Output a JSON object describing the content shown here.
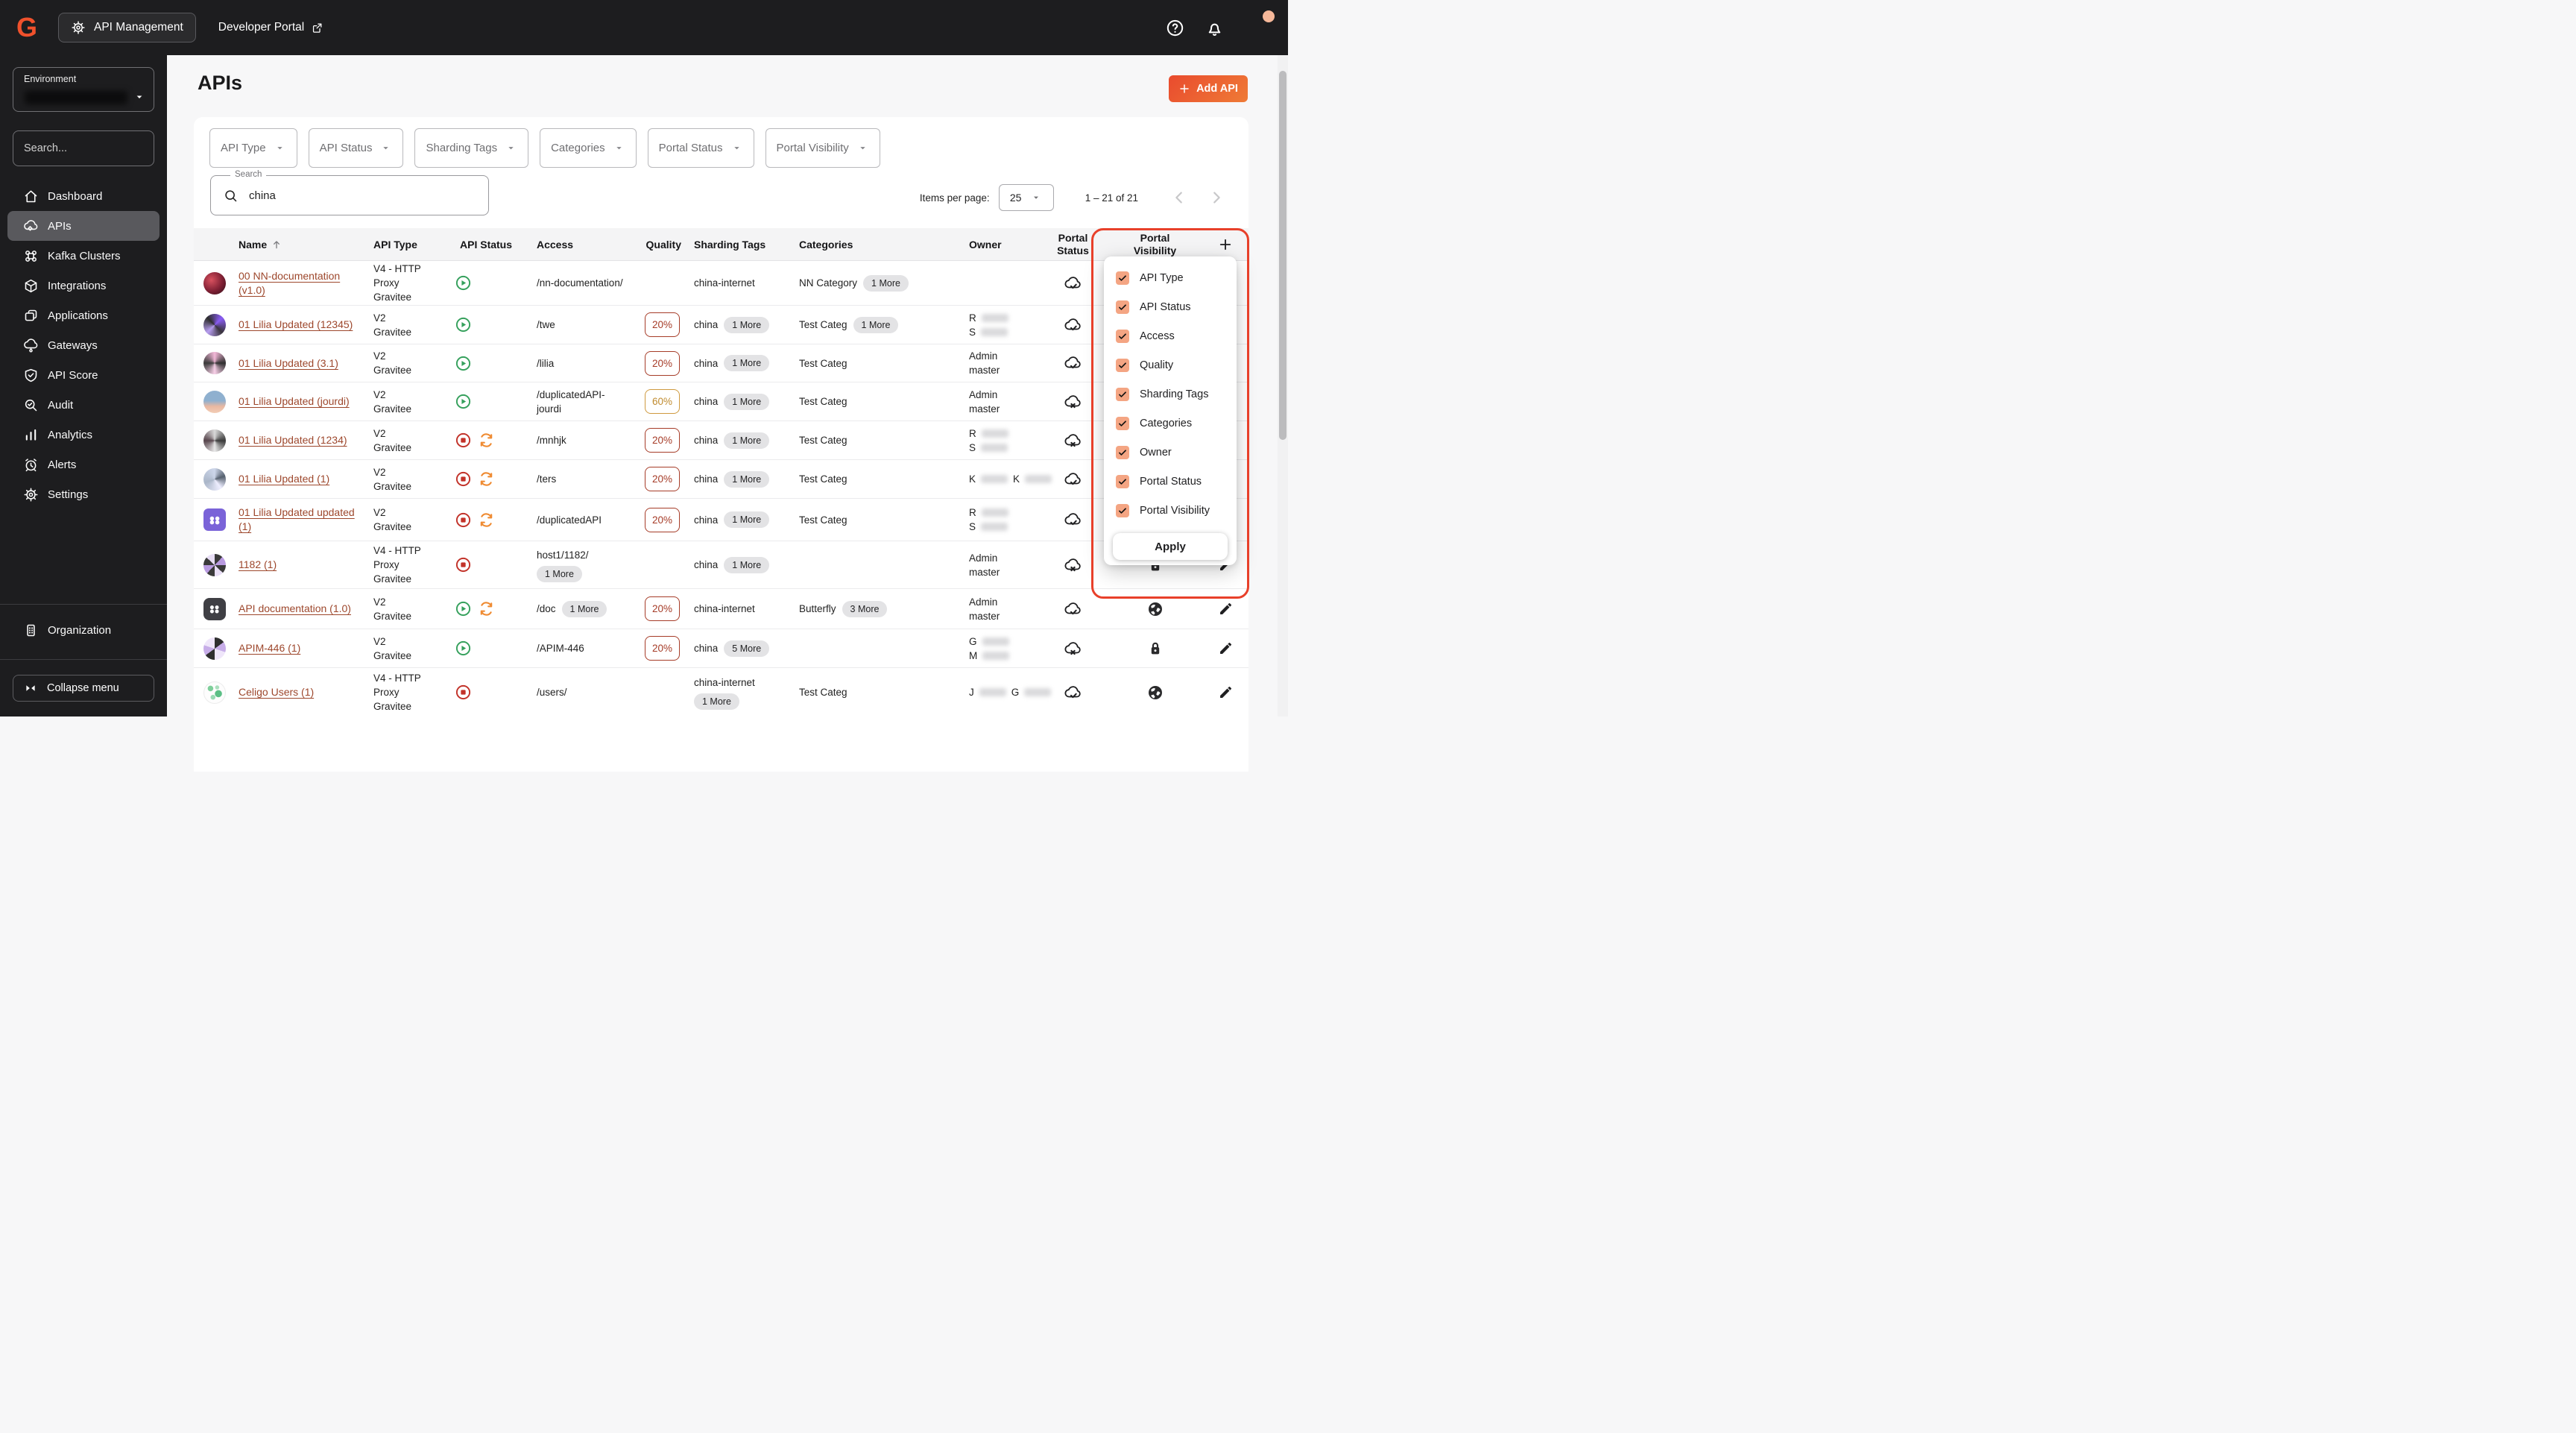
{
  "topbar": {
    "app_title": "API Management",
    "portal_label": "Developer Portal"
  },
  "sidebar": {
    "environment_label": "Environment",
    "environment_value_redacted": true,
    "search_placeholder": "Search...",
    "items": [
      {
        "label": "Dashboard",
        "icon": "home"
      },
      {
        "label": "APIs",
        "icon": "cloud-gear"
      },
      {
        "label": "Kafka Clusters",
        "icon": "kafka"
      },
      {
        "label": "Integrations",
        "icon": "cube"
      },
      {
        "label": "Applications",
        "icon": "windows"
      },
      {
        "label": "Gateways",
        "icon": "cloud-node"
      },
      {
        "label": "API Score",
        "icon": "shield-check"
      },
      {
        "label": "Audit",
        "icon": "search-check"
      },
      {
        "label": "Analytics",
        "icon": "bar-chart"
      },
      {
        "label": "Alerts",
        "icon": "alarm"
      },
      {
        "label": "Settings",
        "icon": "gear"
      }
    ],
    "selected": "APIs",
    "organization_label": "Organization",
    "collapse_label": "Collapse menu"
  },
  "header": {
    "title": "APIs",
    "add_label": "Add API"
  },
  "filters": {
    "dropdowns": [
      "API Type",
      "API Status",
      "Sharding Tags",
      "Categories",
      "Portal Status",
      "Portal Visibility"
    ]
  },
  "search": {
    "label": "Search",
    "value": "china"
  },
  "pagination": {
    "items_per_page_label": "Items per page:",
    "items_per_page": "25",
    "range": "1 – 21 of 21"
  },
  "table": {
    "columns": [
      "Name",
      "API Type",
      "API Status",
      "Access",
      "Quality",
      "Sharding Tags",
      "Categories",
      "Owner",
      "Portal Status",
      "Portal Visibility"
    ],
    "rows": [
      {
        "name": "00 NN-documentation (v1.0)",
        "avatar": "crowd-photo",
        "type_lines": [
          "V4 - HTTP",
          "Proxy",
          "Gravitee"
        ],
        "status": [
          "started"
        ],
        "access": "/nn-documentation/",
        "access_more": null,
        "quality": null,
        "tags": {
          "label": "china-internet",
          "more": null,
          "more_pos": "inline"
        },
        "categories": {
          "label": "NN Category",
          "more": "1 More"
        },
        "owner": {
          "lines": [],
          "redacted": false
        },
        "portal_status": "published",
        "visibility": null
      },
      {
        "name": "01 Lilia Updated (12345)",
        "avatar": "purple-pattern",
        "type_lines": [
          "V2",
          "Gravitee"
        ],
        "status": [
          "started"
        ],
        "access": "/twe",
        "access_more": null,
        "quality": "20%",
        "tags": {
          "label": "china",
          "more": "1 More",
          "more_pos": "inline"
        },
        "categories": {
          "label": "Test Categ",
          "more": "1 More"
        },
        "owner": {
          "lines": [
            [
              "R"
            ],
            [
              "S"
            ]
          ],
          "redacted": true
        },
        "portal_status": "published",
        "visibility": null
      },
      {
        "name": "01 Lilia Updated (3.1)",
        "avatar": "pink-pattern",
        "type_lines": [
          "V2",
          "Gravitee"
        ],
        "status": [
          "started"
        ],
        "access": "/lilia",
        "access_more": null,
        "quality": "20%",
        "tags": {
          "label": "china",
          "more": "1 More",
          "more_pos": "inline"
        },
        "categories": {
          "label": "Test Categ",
          "more": null
        },
        "owner": {
          "lines": [
            [
              "Admin"
            ],
            [
              "master"
            ]
          ],
          "redacted": false
        },
        "portal_status": "published",
        "visibility": null
      },
      {
        "name": "01 Lilia Updated (jourdi)",
        "avatar": "sky-photo",
        "type_lines": [
          "V2",
          "Gravitee"
        ],
        "status": [
          "started"
        ],
        "access": "/duplicatedAPI-jourdi",
        "access_more": null,
        "quality": "60%",
        "tags": {
          "label": "china",
          "more": "1 More",
          "more_pos": "inline"
        },
        "categories": {
          "label": "Test Categ",
          "more": null
        },
        "owner": {
          "lines": [
            [
              "Admin"
            ],
            [
              "master"
            ]
          ],
          "redacted": false
        },
        "portal_status": "unpublished",
        "visibility": null
      },
      {
        "name": "01 Lilia Updated (1234)",
        "avatar": "gray-pattern",
        "type_lines": [
          "V2",
          "Gravitee"
        ],
        "status": [
          "stopped",
          "sync"
        ],
        "access": "/mnhjk",
        "access_more": null,
        "quality": "20%",
        "tags": {
          "label": "china",
          "more": "1 More",
          "more_pos": "inline"
        },
        "categories": {
          "label": "Test Categ",
          "more": null
        },
        "owner": {
          "lines": [
            [
              "R"
            ],
            [
              "S"
            ]
          ],
          "redacted": true
        },
        "portal_status": "unpublished",
        "visibility": null
      },
      {
        "name": "01 Lilia Updated (1)",
        "avatar": "lightblue-pattern",
        "type_lines": [
          "V2",
          "Gravitee"
        ],
        "status": [
          "stopped",
          "sync"
        ],
        "access": "/ters",
        "access_more": null,
        "quality": "20%",
        "tags": {
          "label": "china",
          "more": "1 More",
          "more_pos": "inline"
        },
        "categories": {
          "label": "Test Categ",
          "more": null
        },
        "owner": {
          "lines": [
            [
              "K",
              "K"
            ]
          ],
          "redacted": true
        },
        "portal_status": "published",
        "visibility": null
      },
      {
        "name": "01 Lilia Updated updated (1)",
        "avatar": "purple-hex",
        "type_lines": [
          "V2",
          "Gravitee"
        ],
        "status": [
          "stopped",
          "sync"
        ],
        "access": "/duplicatedAPI",
        "access_more": null,
        "quality": "20%",
        "tags": {
          "label": "china",
          "more": "1 More",
          "more_pos": "inline"
        },
        "categories": {
          "label": "Test Categ",
          "more": null
        },
        "owner": {
          "lines": [
            [
              "R"
            ],
            [
              "S"
            ]
          ],
          "redacted": true
        },
        "portal_status": "published",
        "visibility": null
      },
      {
        "name": "1182 (1)",
        "avatar": "purple-diamond",
        "type_lines": [
          "V4 - HTTP",
          "Proxy",
          "Gravitee"
        ],
        "status": [
          "stopped"
        ],
        "access": "host1/1182/",
        "access_more": {
          "label": "1 More",
          "pos": "below"
        },
        "quality": null,
        "tags": {
          "label": "china",
          "more": "1 More",
          "more_pos": "inline"
        },
        "categories": {
          "label": null,
          "more": null
        },
        "owner": {
          "lines": [
            [
              "Admin"
            ],
            [
              "master"
            ]
          ],
          "redacted": false
        },
        "portal_status": "unpublished",
        "visibility": "private"
      },
      {
        "name": "API documentation (1.0)",
        "avatar": "dark-badge",
        "type_lines": [
          "V2",
          "Gravitee"
        ],
        "status": [
          "started",
          "sync"
        ],
        "access": "/doc",
        "access_more": {
          "label": "1 More",
          "pos": "inline"
        },
        "quality": "20%",
        "tags": {
          "label": "china-internet",
          "more": null,
          "more_pos": "inline"
        },
        "categories": {
          "label": "Butterfly",
          "more": "3 More"
        },
        "owner": {
          "lines": [
            [
              "Admin"
            ],
            [
              "master"
            ]
          ],
          "redacted": false
        },
        "portal_status": "published",
        "visibility": "public"
      },
      {
        "name": "APIM-446 (1)",
        "avatar": "purple-diamond2",
        "type_lines": [
          "V2",
          "Gravitee"
        ],
        "status": [
          "started"
        ],
        "access": "/APIM-446",
        "access_more": null,
        "quality": "20%",
        "tags": {
          "label": "china",
          "more": "5 More",
          "more_pos": "inline"
        },
        "categories": {
          "label": null,
          "more": null
        },
        "owner": {
          "lines": [
            [
              "G"
            ],
            [
              "M"
            ]
          ],
          "redacted": true
        },
        "portal_status": "unpublished",
        "visibility": "private"
      },
      {
        "name": "Celigo Users (1)",
        "avatar": "green-sparkle",
        "type_lines": [
          "V4 - HTTP",
          "Proxy",
          "Gravitee"
        ],
        "status": [
          "stopped"
        ],
        "access": "/users/",
        "access_more": null,
        "quality": null,
        "tags": {
          "label": "china-internet",
          "more": "1 More",
          "more_pos": "below"
        },
        "categories": {
          "label": "Test Categ",
          "more": null
        },
        "owner": {
          "lines": [
            [
              "J",
              "G"
            ]
          ],
          "redacted": true
        },
        "portal_status": "published",
        "visibility": "public"
      }
    ]
  },
  "column_picker": {
    "options": [
      {
        "label": "API Type",
        "checked": true
      },
      {
        "label": "API Status",
        "checked": true
      },
      {
        "label": "Access",
        "checked": true
      },
      {
        "label": "Quality",
        "checked": true
      },
      {
        "label": "Sharding Tags",
        "checked": true
      },
      {
        "label": "Categories",
        "checked": true
      },
      {
        "label": "Owner",
        "checked": true
      },
      {
        "label": "Portal Status",
        "checked": true
      },
      {
        "label": "Portal Visibility",
        "checked": true
      }
    ],
    "apply_label": "Apply"
  },
  "colors": {
    "accent_orange": "#ee5a2c",
    "link_rust": "#9d472c",
    "quality_red": "#a63c28",
    "quality_amber": "#cf9a3f",
    "checkbox_salmon": "#f4a583",
    "highlight_red": "#e8402a",
    "status_green": "#35a05c",
    "status_red": "#c23229",
    "sync_orange": "#ef8b32",
    "dark_chrome": "#1d1d1f"
  }
}
